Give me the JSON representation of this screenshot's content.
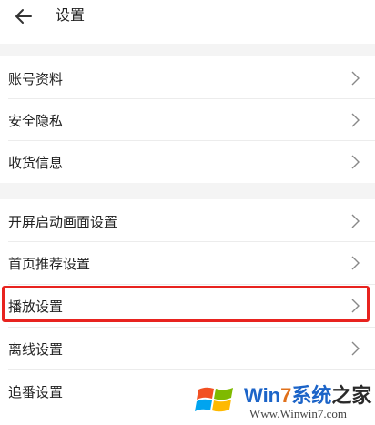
{
  "header": {
    "title": "设置",
    "back_icon": "arrow-left-icon"
  },
  "groups": [
    {
      "items": [
        {
          "label": "账号资料"
        },
        {
          "label": "安全隐私"
        },
        {
          "label": "收货信息"
        }
      ]
    },
    {
      "items": [
        {
          "label": "开屏启动画面设置"
        },
        {
          "label": "首页推荐设置"
        },
        {
          "label": "播放设置",
          "highlighted": true
        },
        {
          "label": "离线设置"
        },
        {
          "label": "追番设置"
        }
      ]
    }
  ],
  "watermark": {
    "part1": "Win",
    "part2": "7",
    "part3": "系统",
    "part4": "之家",
    "url": "Www.Winwin7.com"
  },
  "colors": {
    "highlight": "#e8231f",
    "background": "#f4f4f4",
    "brand_blue": "#1c64c8",
    "brand_orange": "#e0701a"
  }
}
